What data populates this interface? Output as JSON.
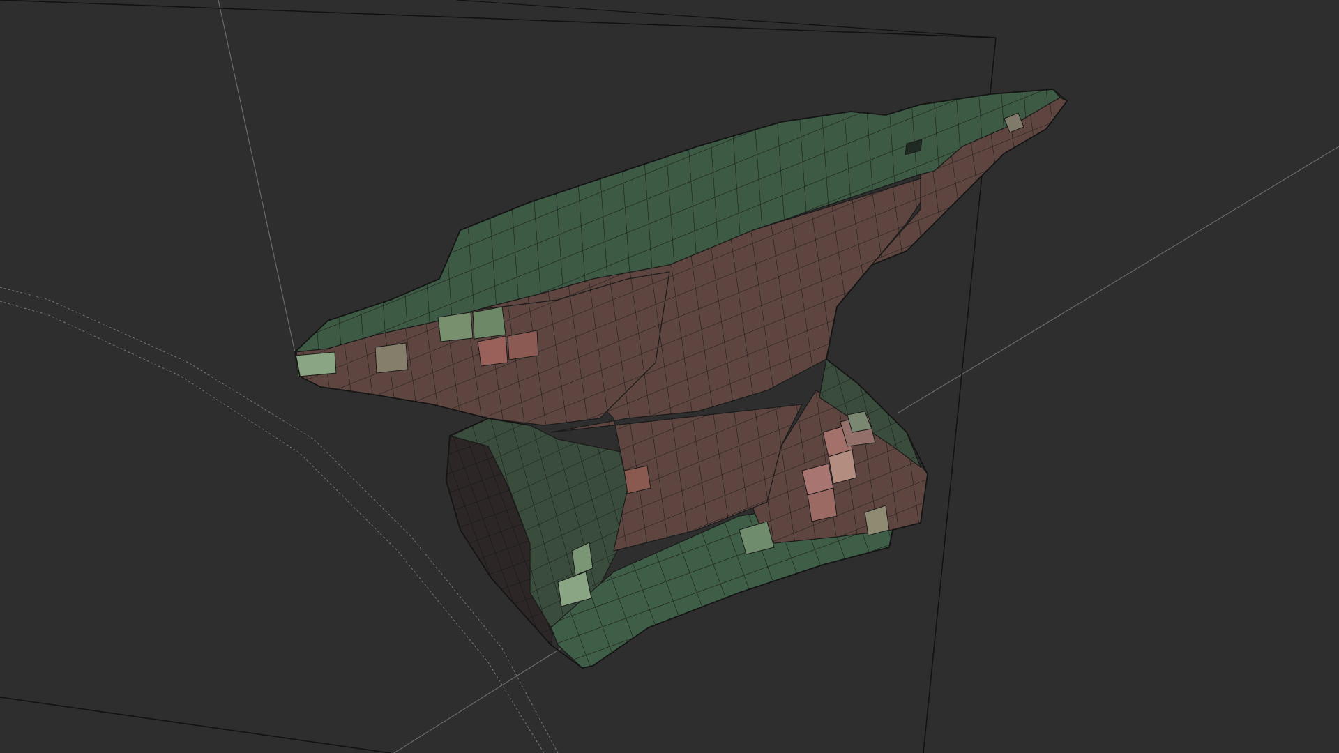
{
  "viewport": {
    "background_color": "#2e2e2e",
    "grid_line_color": "#6a6a6a",
    "bounding_box_line_color": "#111111",
    "wire_color": "#1a1a1a",
    "dashed_line_color": "#7a7a7a"
  },
  "model": {
    "name_icon": "anvil-mesh",
    "top_face_color": "#3d5a45",
    "side_face_color": "#5e4540",
    "base_face_color": "#3a4d3c",
    "highlight_green": "#8aa583",
    "highlight_pink": "#a4706a",
    "shadow_color": "#2c2626"
  }
}
